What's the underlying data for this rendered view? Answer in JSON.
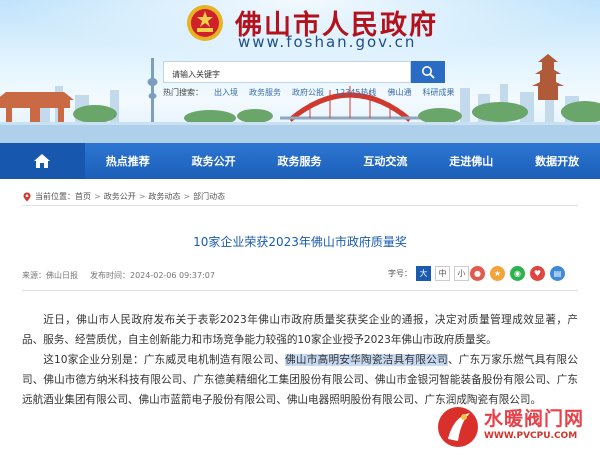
{
  "header": {
    "title": "佛山市人民政府",
    "url": "www.foshan.gov.cn",
    "search_placeholder": "请输入关键字"
  },
  "hot_search": {
    "label": "热门搜索：",
    "items": [
      "出入境",
      "政务服务",
      "政府公报",
      "12345热线",
      "佛山通",
      "科研成果"
    ]
  },
  "nav": {
    "items": [
      "热点推荐",
      "政务公开",
      "政务服务",
      "互动交流",
      "走进佛山",
      "数据开放"
    ]
  },
  "breadcrumb": {
    "label": "当前位置：",
    "items": [
      "首页",
      "政务公开",
      "政务动态",
      "部门动态"
    ]
  },
  "article": {
    "title": "10家企业荣获2023年佛山市政府质量奖",
    "source": "来源：佛山日报",
    "date": "发布时间：2024-02-06 09:37:07",
    "font_size_label": "字号：",
    "font_sizes": [
      "大",
      "中",
      "小"
    ],
    "p1": "近日，佛山市人民政府发布关于表彰2023年佛山市政府质量奖获奖企业的通报，决定对质量管理成效显著，产品、服务、经营质优，自主创新能力和市场竞争能力较强的10家企业授予2023年佛山市政府质量奖。",
    "p2_a": "这10家企业分别是：广东威灵电机制造有限公司、",
    "p2_hl": "佛山市高明安华陶瓷洁具有限公司",
    "p2_b": "、广东万家乐燃气具有限公司、佛山市德方纳米科技有限公司、广东德美精细化工集团股份有限公司、佛山市金银河智能装备股份有限公司、广东远航酒业集团有限公司、佛山市蓝箭电子股份有限公司、佛山电器照明股份有限公司、广东",
    "p2_c": "润成陶瓷有限公司。"
  },
  "watermark": {
    "text": "水暖阀门网",
    "url": "WWW.PVCPU.COM"
  },
  "colors": {
    "title_red": "#b3121c",
    "nav_blue": "#2c76d2",
    "link_blue": "#1a5bb0"
  }
}
